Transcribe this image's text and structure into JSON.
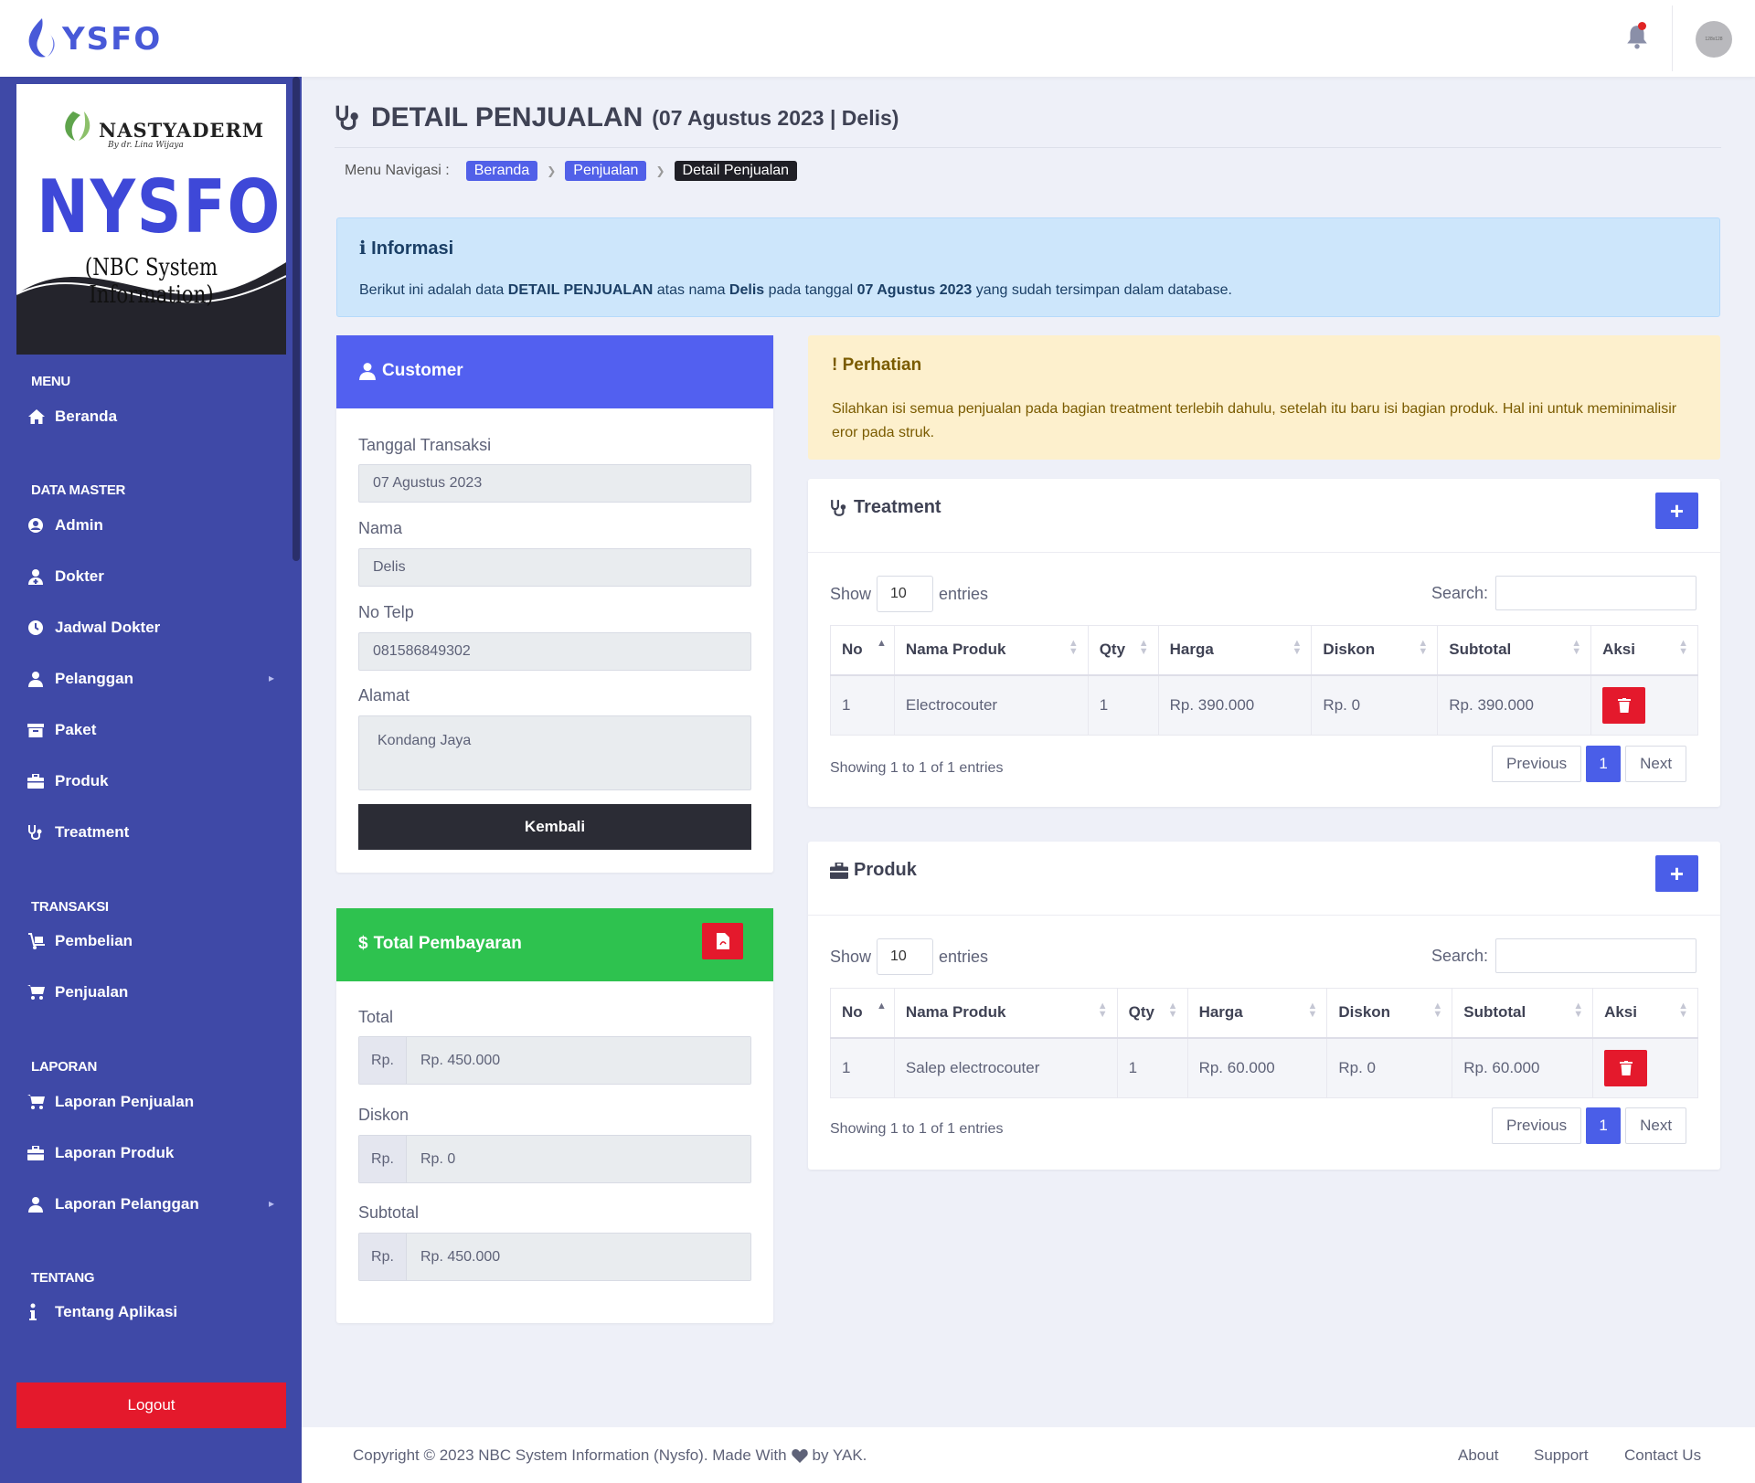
{
  "brand": {
    "name": "YSFO",
    "accent": "#4859d8"
  },
  "user": {
    "avatar_text": "128x128"
  },
  "sidebar": {
    "logo": {
      "company": "NASTYADERM",
      "tagline": "By dr. Lina Wijaya",
      "app_short": "NYSFO",
      "app_long": "(NBC System Information)"
    },
    "sections": [
      {
        "label": "MENU"
      },
      {
        "label": "DATA MASTER"
      },
      {
        "label": "TRANSAKSI"
      },
      {
        "label": "LAPORAN"
      },
      {
        "label": "TENTANG"
      }
    ],
    "items": [
      {
        "label": "Beranda",
        "icon": "home-icon"
      },
      {
        "label": "Admin",
        "icon": "user-circle-icon"
      },
      {
        "label": "Dokter",
        "icon": "doctor-icon"
      },
      {
        "label": "Jadwal Dokter",
        "icon": "clock-icon"
      },
      {
        "label": "Pelanggan",
        "icon": "user-icon",
        "has_submenu": true
      },
      {
        "label": "Paket",
        "icon": "box-icon"
      },
      {
        "label": "Produk",
        "icon": "briefcase-icon"
      },
      {
        "label": "Treatment",
        "icon": "stethoscope-icon"
      },
      {
        "label": "Pembelian",
        "icon": "dolly-icon"
      },
      {
        "label": "Penjualan",
        "icon": "cart-icon"
      },
      {
        "label": "Laporan Penjualan",
        "icon": "cart-icon"
      },
      {
        "label": "Laporan Produk",
        "icon": "briefcase-icon"
      },
      {
        "label": "Laporan Pelanggan",
        "icon": "user-icon",
        "has_submenu": true
      },
      {
        "label": "Tentang Aplikasi",
        "icon": "info-icon"
      }
    ],
    "logout_label": "Logout"
  },
  "page": {
    "title": "DETAIL PENJUALAN",
    "subtitle": "(07 Agustus 2023 | Delis)",
    "breadcrumb_label": "Menu Navigasi :",
    "breadcrumb": [
      "Beranda",
      "Penjualan",
      "Detail Penjualan"
    ]
  },
  "info_alert": {
    "title": "Informasi",
    "text_parts": [
      "Berikut ini adalah data ",
      "DETAIL PENJUALAN",
      " atas nama ",
      "Delis",
      " pada tanggal ",
      "07 Agustus 2023",
      " yang sudah tersimpan dalam database."
    ]
  },
  "customer": {
    "title": "Customer",
    "header_color": "#5260f0",
    "fields": {
      "tanggal_label": "Tanggal Transaksi",
      "tanggal_value": "07 Agustus 2023",
      "nama_label": "Nama",
      "nama_value": "Delis",
      "telp_label": "No Telp",
      "telp_value": "081586849302",
      "alamat_label": "Alamat",
      "alamat_value": "Kondang Jaya"
    },
    "back_label": "Kembali"
  },
  "payment": {
    "title": "Total Pembayaran",
    "header_color": "#2ec24f",
    "prefix": "Rp.",
    "total_label": "Total",
    "total_value": "Rp. 450.000",
    "diskon_label": "Diskon",
    "diskon_value": "Rp. 0",
    "subtotal_label": "Subtotal",
    "subtotal_value": "Rp. 450.000"
  },
  "warning_alert": {
    "title": "Perhatian",
    "text": "Silahkan isi semua penjualan pada bagian treatment terlebih dahulu, setelah itu baru isi bagian produk. Hal ini untuk meminimalisir eror pada struk."
  },
  "treatment_table": {
    "title": "Treatment",
    "show_label": "Show",
    "entries_label": "entries",
    "length": "10",
    "search_label": "Search:",
    "columns": [
      "No",
      "Nama Produk",
      "Qty",
      "Harga",
      "Diskon",
      "Subtotal",
      "Aksi"
    ],
    "rows": [
      [
        "1",
        "Electrocouter",
        "1",
        "Rp. 390.000",
        "Rp. 0",
        "Rp. 390.000"
      ]
    ],
    "info": "Showing 1 to 1 of 1 entries",
    "pager": {
      "prev": "Previous",
      "page": "1",
      "next": "Next"
    }
  },
  "produk_table": {
    "title": "Produk",
    "show_label": "Show",
    "entries_label": "entries",
    "length": "10",
    "search_label": "Search:",
    "columns": [
      "No",
      "Nama Produk",
      "Qty",
      "Harga",
      "Diskon",
      "Subtotal",
      "Aksi"
    ],
    "rows": [
      [
        "1",
        "Salep electrocouter",
        "1",
        "Rp. 60.000",
        "Rp. 0",
        "Rp. 60.000"
      ]
    ],
    "info": "Showing 1 to 1 of 1 entries",
    "pager": {
      "prev": "Previous",
      "page": "1",
      "next": "Next"
    }
  },
  "footer": {
    "copyright_pre": "Copyright © 2023 NBC System Information (Nysfo). Made With",
    "copyright_post": "by YAK.",
    "links": [
      "About",
      "Support",
      "Contact Us"
    ]
  }
}
